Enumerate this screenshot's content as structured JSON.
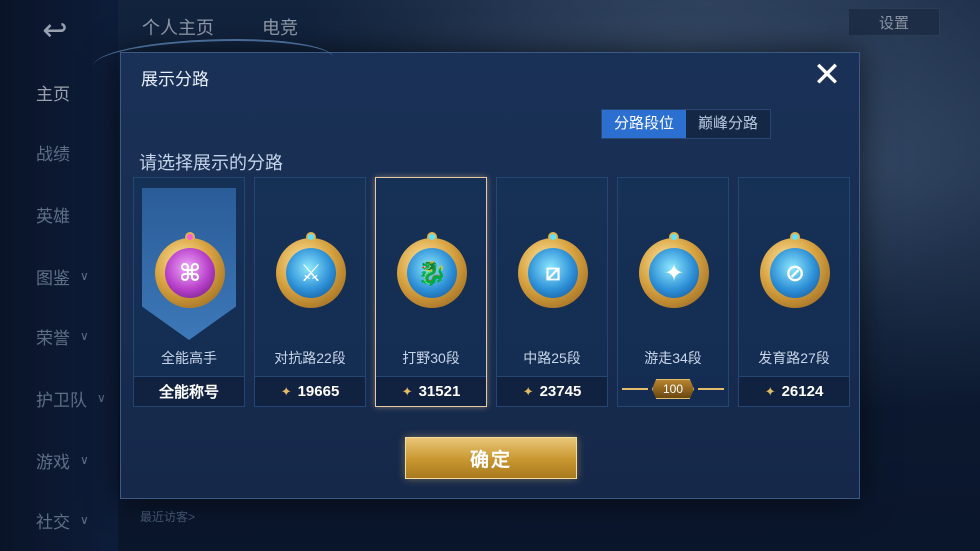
{
  "background": {
    "tabs": [
      "个人主页",
      "电竞"
    ],
    "settings_label": "设置",
    "nav": [
      {
        "label": "主页",
        "active": true,
        "chevron": false
      },
      {
        "label": "战绩",
        "active": false,
        "chevron": false
      },
      {
        "label": "英雄",
        "active": false,
        "chevron": false
      },
      {
        "label": "图鉴",
        "active": false,
        "chevron": true
      },
      {
        "label": "荣誉",
        "active": false,
        "chevron": true
      },
      {
        "label": "护卫队",
        "active": false,
        "chevron": true
      },
      {
        "label": "游戏",
        "active": false,
        "chevron": true
      },
      {
        "label": "社交",
        "active": false,
        "chevron": true
      }
    ],
    "visitors_label": "最近访客>"
  },
  "dialog": {
    "title": "展示分路",
    "prompt": "请选择展示的分路",
    "toggle": [
      {
        "label": "分路段位",
        "active": true
      },
      {
        "label": "巅峰分路",
        "active": false
      }
    ],
    "confirm_label": "确定",
    "cards": [
      {
        "name": "全能高手",
        "footer": "全能称号",
        "score": null,
        "selected": false,
        "highlight": true,
        "badge_color": "purple",
        "icon": "all-rounder-icon",
        "glyph": "⌘"
      },
      {
        "name": "对抗路22段",
        "footer": null,
        "score": "19665",
        "selected": false,
        "highlight": false,
        "badge_color": "blue",
        "icon": "clash-lane-icon",
        "glyph": "⚔"
      },
      {
        "name": "打野30段",
        "footer": null,
        "score": "31521",
        "selected": true,
        "highlight": false,
        "badge_color": "blue",
        "icon": "jungle-icon",
        "glyph": "🐉"
      },
      {
        "name": "中路25段",
        "footer": null,
        "score": "23745",
        "selected": false,
        "highlight": false,
        "badge_color": "blue",
        "icon": "mid-lane-icon",
        "glyph": "⧄"
      },
      {
        "name": "游走34段",
        "footer": null,
        "score": null,
        "selected": false,
        "highlight": false,
        "badge_color": "blue",
        "icon": "roam-icon",
        "glyph": "✦",
        "hundred_badge": "100"
      },
      {
        "name": "发育路27段",
        "footer": null,
        "score": "26124",
        "selected": false,
        "highlight": false,
        "badge_color": "blue",
        "icon": "farm-lane-icon",
        "glyph": "⊘"
      }
    ]
  }
}
